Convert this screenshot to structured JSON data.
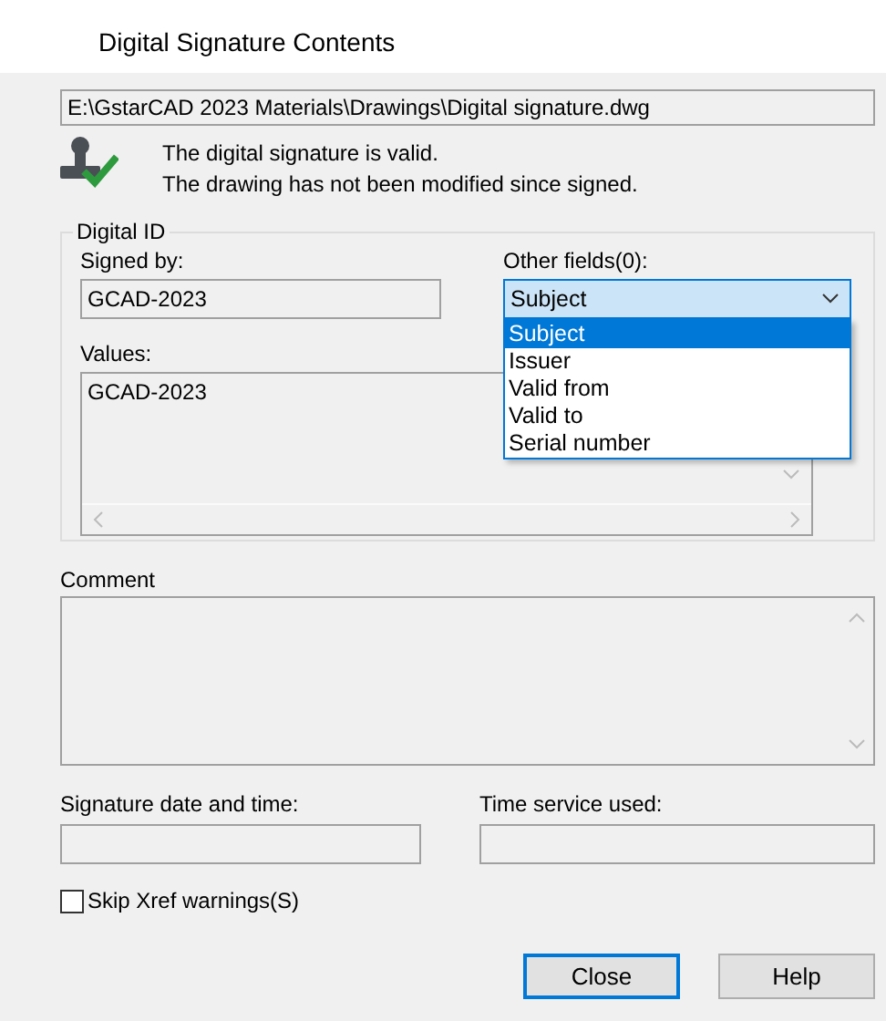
{
  "window": {
    "title": "Digital Signature Contents"
  },
  "file_path": "E:\\GstarCAD 2023 Materials\\Drawings\\Digital signature.dwg",
  "status_lines": [
    "The digital signature is valid.",
    "The drawing has not been modified since signed."
  ],
  "digital_id": {
    "title": "Digital ID",
    "signed_by": {
      "label": "Signed by:",
      "value": "GCAD-2023"
    },
    "other_fields": {
      "label": "Other fields(0):",
      "value": "Subject",
      "expanded": true,
      "options": [
        {
          "label": "Subject",
          "selected": true
        },
        {
          "label": "Issuer",
          "selected": false
        },
        {
          "label": "Valid from",
          "selected": false
        },
        {
          "label": "Valid to",
          "selected": false
        },
        {
          "label": "Serial number",
          "selected": false
        }
      ]
    },
    "values": {
      "label": "Values:",
      "value": "GCAD-2023"
    }
  },
  "comment": {
    "label": "Comment"
  },
  "signature_time": {
    "label": "Signature date and time:"
  },
  "time_service": {
    "label": "Time service used:"
  },
  "skip_xref": {
    "label": "Skip Xref warnings(S)",
    "checked": false
  },
  "buttons": [
    {
      "label": "Close",
      "default": true
    },
    {
      "label": "Help",
      "default": false
    }
  ]
}
